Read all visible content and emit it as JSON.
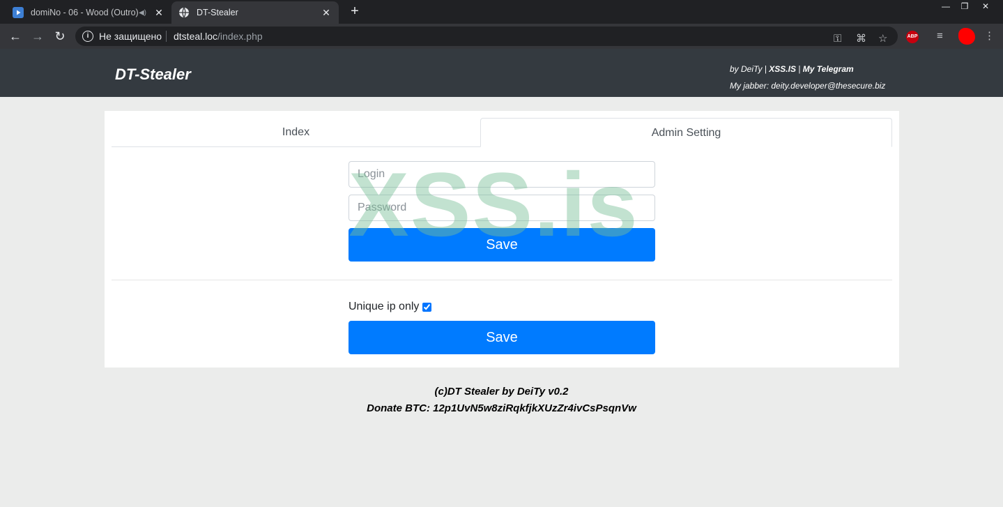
{
  "browser": {
    "tabs": [
      {
        "title": "domiNo - 06 - Wood (Outro)",
        "icon": "youtube-play-icon",
        "audio": "speaker-icon"
      },
      {
        "title": "DT-Stealer",
        "icon": "globe-icon"
      }
    ],
    "new_tab": "+",
    "window_controls": {
      "minimize": "—",
      "restore": "❐",
      "close": "✕"
    },
    "omnibox": {
      "security_label": "Не защищено",
      "host": "dtsteal.loc",
      "path": "/index.php"
    }
  },
  "header": {
    "brand": "DT-Stealer",
    "credits_by": "by DeiTy",
    "credits_sep": "|",
    "link_xss": "XSS.IS",
    "link_telegram": "My Telegram",
    "jabber": "My jabber: deity.developer@thesecure.biz"
  },
  "tabs": {
    "index": "Index",
    "admin": "Admin Setting"
  },
  "form": {
    "login_placeholder": "Login",
    "password_placeholder": "Password",
    "save1": "Save",
    "unique_ip_label": "Unique ip only",
    "unique_ip_checked": true,
    "save2": "Save"
  },
  "watermark": "XSS.is",
  "footer": {
    "line1": "(c)DT Stealer by DeiTy v0.2",
    "line2": "Donate BTC: 12p1UvN5w8ziRqkfjkXUzZr4ivCsPsqnVw"
  },
  "colors": {
    "primary": "#007bff",
    "header_bg": "#343a40",
    "page_bg": "#ebeceb"
  }
}
